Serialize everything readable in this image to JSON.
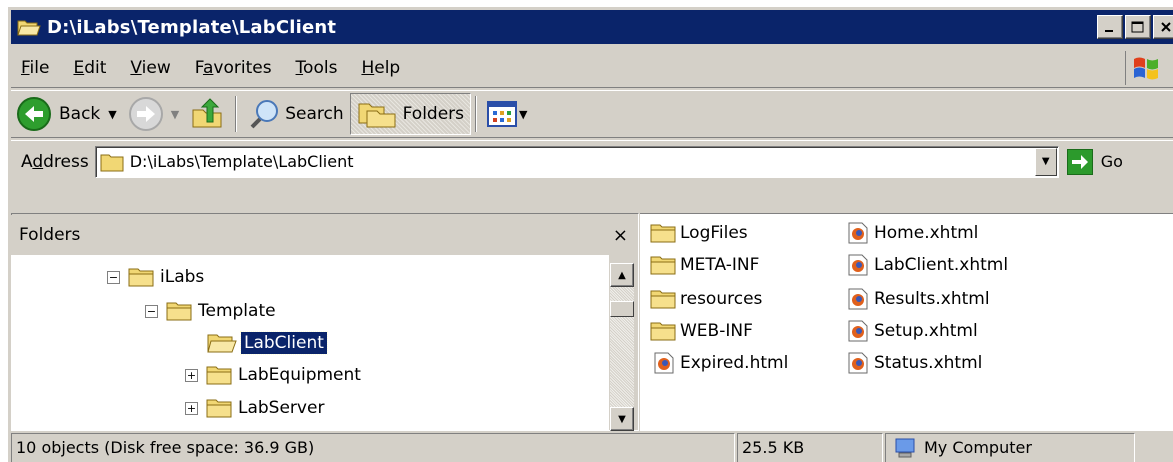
{
  "window": {
    "title": "D:\\iLabs\\Template\\LabClient"
  },
  "menu": [
    {
      "accel": "F",
      "rest": "ile"
    },
    {
      "accel": "E",
      "rest": "dit"
    },
    {
      "accel": "V",
      "rest": "iew"
    },
    {
      "pre": "F",
      "accel": "a",
      "rest": "vorites"
    },
    {
      "accel": "T",
      "rest": "ools"
    },
    {
      "accel": "H",
      "rest": "elp"
    }
  ],
  "toolbar": {
    "back_label": "Back",
    "search_label": "Search",
    "folders_label": "Folders"
  },
  "address": {
    "label_pre": "A",
    "label_accel": "d",
    "label_rest": "dress",
    "value": "D:\\iLabs\\Template\\LabClient",
    "go_label": "Go"
  },
  "folders_pane": {
    "title": "Folders",
    "close": "×",
    "tree": [
      {
        "label": "iLabs",
        "expander": "−"
      },
      {
        "label": "Template",
        "expander": "−"
      },
      {
        "label": "LabClient",
        "expander": "",
        "selected": true
      },
      {
        "label": "LabEquipment",
        "expander": "+"
      },
      {
        "label": "LabServer",
        "expander": "+"
      }
    ]
  },
  "files": {
    "col1": [
      {
        "name": "LogFiles",
        "icon": "folder-icon"
      },
      {
        "name": "META-INF",
        "icon": "folder-icon"
      },
      {
        "name": "resources",
        "icon": "folder-icon"
      },
      {
        "name": "WEB-INF",
        "icon": "folder-icon"
      },
      {
        "name": "Expired.html",
        "icon": "firefox-document-icon"
      }
    ],
    "col2": [
      {
        "name": "Home.xhtml",
        "icon": "firefox-document-icon"
      },
      {
        "name": "LabClient.xhtml",
        "icon": "firefox-document-icon"
      },
      {
        "name": "Results.xhtml",
        "icon": "firefox-document-icon"
      },
      {
        "name": "Setup.xhtml",
        "icon": "firefox-document-icon"
      },
      {
        "name": "Status.xhtml",
        "icon": "firefox-document-icon"
      }
    ]
  },
  "status": {
    "objects": "10 objects (Disk free space: 36.9 GB)",
    "size": "25.5 KB",
    "zone": "My Computer"
  },
  "colors": {
    "title_bg": "#0a246a",
    "chrome": "#d4d0c8",
    "selection": "#0a246a",
    "folder": "#f1d774"
  }
}
